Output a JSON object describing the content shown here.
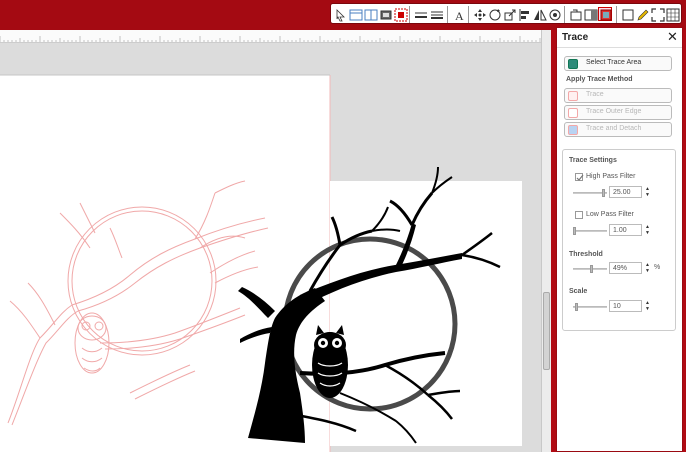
{
  "toolbar": {
    "tools": [
      "select",
      "view-grid",
      "view-split",
      "preview",
      "weld",
      "line-style",
      "line-settings",
      "text",
      "move",
      "rotate",
      "scale",
      "align",
      "mirror",
      "replicate",
      "trace-settings",
      "layers",
      "trace",
      "fill",
      "pen",
      "fullscreen",
      "library"
    ]
  },
  "panel": {
    "title": "Trace",
    "close": "✕",
    "select_trace_area": "Select Trace Area",
    "apply_trace_method": "Apply Trace Method",
    "methods": [
      "Trace",
      "Trace Outer Edge",
      "Trace and Detach"
    ],
    "settings_title": "Trace Settings",
    "high_pass": {
      "label": "High Pass Filter",
      "checked": true,
      "value": "25.00",
      "slider": 0.95
    },
    "low_pass": {
      "label": "Low Pass Filter",
      "checked": false,
      "value": "1.00",
      "slider": 0.0
    },
    "threshold": {
      "label": "Threshold",
      "value": "49%",
      "unit": "%",
      "slider": 0.55
    },
    "scale": {
      "label": "Scale",
      "value": "10",
      "slider": 0.05
    }
  },
  "colors": {
    "accent": "#a40a12",
    "trace_outline": "#f0a8a8",
    "image_fill": "#000000"
  }
}
